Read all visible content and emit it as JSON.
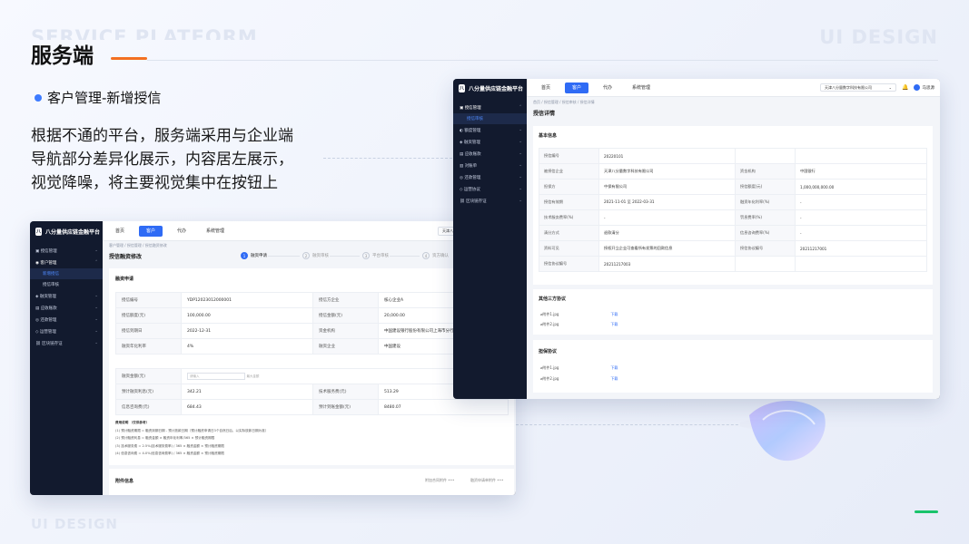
{
  "watermark": {
    "top_left": "SERVICE PLATFORM",
    "top_right": "UI DESIGN",
    "bottom_left": "UI DESIGN"
  },
  "title": "服务端",
  "subhead": "客户管理-新增授信",
  "description": [
    "根据不通的平台，服务端采用与企业端",
    "导航部分差异化展示，内容居左展示，",
    "视觉降噪，将主要视觉集中在按钮上"
  ],
  "colors": {
    "accent": "#2f6bf5",
    "title_underline": "#f37021",
    "green_mark": "#19c36b",
    "sidebar_bg": "#121a2e"
  },
  "left_app": {
    "brand": "八分量供应链金融平台",
    "sidebar": [
      {
        "label": "授信管理",
        "icon": "file-icon"
      },
      {
        "label": "客户管理",
        "icon": "user-icon",
        "expanded": true
      },
      {
        "label": "新增授信",
        "sub": true,
        "active": true
      },
      {
        "label": "授信审核",
        "sub": true
      },
      {
        "label": "融资管理",
        "icon": "money-icon"
      },
      {
        "label": "应收账款",
        "icon": "doc-icon"
      },
      {
        "label": "还款管理",
        "icon": "repay-icon"
      },
      {
        "label": "运营管理",
        "icon": "ops-icon"
      },
      {
        "label": "区块链存证",
        "icon": "chain-icon"
      }
    ],
    "tabs": [
      "首页",
      "客户",
      "代办",
      "系统管理"
    ],
    "active_tab": 1,
    "company": "天津八分量数字科技有限公司",
    "breadcrumb": "客户管理 / 授信管理 / 授信融资修改",
    "page_title": "授信融资修改",
    "steps": [
      "融资申请",
      "融资审核",
      "平台审核",
      "资方确认"
    ],
    "section_title": "融资申请",
    "rows1": [
      [
        "授信编号",
        "YDP12023012000001",
        "授信方企业",
        "核心企业A"
      ],
      [
        "授信额度(元)",
        "100,000.00",
        "授信金额(元)",
        "20,000.00"
      ],
      [
        "授信到期日",
        "2022-12-31",
        "资金机构",
        "中国建设银行股份有限公司上海市分行"
      ],
      [
        "融资年化利率",
        "4%",
        "融资企业",
        "中国建设"
      ]
    ],
    "finance_amount_label": "融资金额(元)",
    "finance_amount_placeholder": "请输入",
    "finance_amount_hint": "最大金额",
    "rows2": [
      [
        "预计融资利息(元)",
        "342.21",
        "技术服务费(元)",
        "513.29"
      ],
      [
        "信息咨询费(元)",
        "684.43",
        "预计到账金额(元)",
        "8480.07"
      ]
    ],
    "notes_title": "费用说明 （仅供参考）",
    "notes": [
      "(1) 预计融资期限 = 融资到期日期 - 预计放款日期（预计融资申请日3个自然日后，以实际放款日期为准）",
      "(2) 预计融资利息 = 融资金额 × 融资年化利率/365 × 预计融资期限",
      "(3) 技术服务费 = 2.5%(技术服务费率) / 365 × 融资金额 × 预计融资期限",
      "(4) 信息咨询费 = 4.0%(信息咨询费率) / 365 × 融资金额 × 预计融资期限"
    ],
    "bottom_section": "附件信息",
    "bottom_links": [
      "附加合同附件",
      "融资申请单附件"
    ]
  },
  "right_app": {
    "brand": "八分量供应链金融平台",
    "sidebar": [
      {
        "label": "授信管理",
        "icon": "file-icon",
        "expanded": true
      },
      {
        "label": "授信审核",
        "sub": true,
        "active": true
      },
      {
        "label": "额度管理",
        "icon": "limit-icon"
      },
      {
        "label": "融资管理",
        "icon": "money-icon"
      },
      {
        "label": "应收账款",
        "icon": "doc-icon"
      },
      {
        "label": "对账单",
        "icon": "bill-icon"
      },
      {
        "label": "还款管理",
        "icon": "repay-icon"
      },
      {
        "label": "运营协议",
        "icon": "ops-icon"
      },
      {
        "label": "区块链存证",
        "icon": "chain-icon"
      }
    ],
    "tabs": [
      "首页",
      "客户",
      "代办",
      "系统管理"
    ],
    "active_tab": 1,
    "company": "天津八分量数字科技有限公司",
    "user": "马思源",
    "breadcrumb": "首页 / 授信管理 / 授信审核 / 授信详情",
    "page_title": "授信详情",
    "basic_title": "基本信息",
    "basic_rows": [
      [
        "授信编号",
        "20220101",
        "",
        ""
      ],
      [
        "被授信企业",
        "天津八分量数字科技有限公司",
        "资金机构",
        "中国银行"
      ],
      [
        "担保方",
        "中保有限公司",
        "授信额度(元)",
        "1,000,000,000.00"
      ],
      [
        "授信有效期",
        "2021-11-01 至 2022-03-31",
        "融资年化利率(%)",
        "-"
      ],
      [
        "技术服务费率(%)",
        "-",
        "罚息费率(%)",
        "-"
      ],
      [
        "清分方式",
        "退款清分",
        "信息咨询费率(%)",
        "-"
      ],
      [
        "资料可见",
        "授权开立企业可查看所有发票的回款信息",
        "授信协议编号",
        "20211217001"
      ],
      [
        "授信协议编号",
        "20211217003",
        "",
        ""
      ]
    ],
    "third_title": "其他三方协议",
    "third_files": [
      {
        "name": "附件1.jpg",
        "action": "下载"
      },
      {
        "name": "附件2.jpg",
        "action": "下载"
      }
    ],
    "guarantee_title": "担保协议",
    "guarantee_files": [
      {
        "name": "附件1.jpg",
        "action": "下载"
      },
      {
        "name": "附件2.jpg",
        "action": "下载"
      }
    ]
  }
}
